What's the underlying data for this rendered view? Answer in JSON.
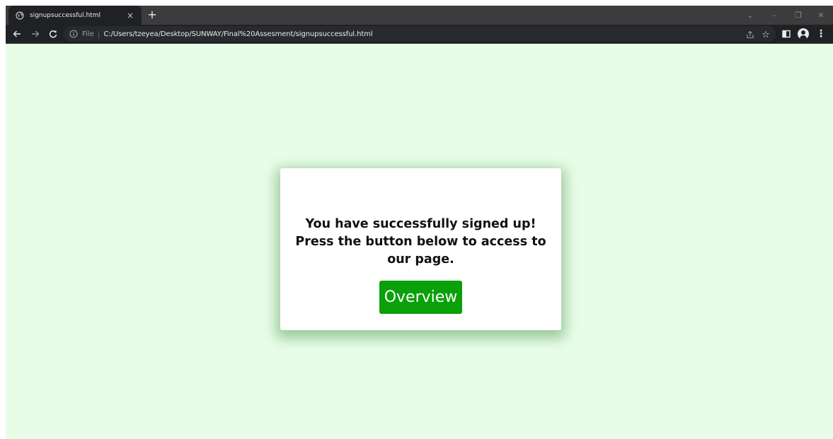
{
  "browser": {
    "tab": {
      "title": "signupsuccessful.html",
      "close_glyph": "×"
    },
    "new_tab_glyph": "+",
    "window_controls": {
      "dropdown": "⌄",
      "minimize": "–",
      "restore": "❐",
      "close": "✕"
    },
    "nav": {
      "back_glyph": "←",
      "forward_glyph": "→",
      "reload_glyph": "C"
    },
    "address_bar": {
      "scheme_label": "File",
      "separator": "|",
      "url": "C:/Users/tzeyea/Desktop/SUNWAY/Final%20Assesment/signupsuccessful.html"
    },
    "bookmark_glyph": "☆",
    "menu_glyph": "⋮"
  },
  "page": {
    "background_color": "#e8fde8",
    "message_lines": [
      "You have successfully signed up!",
      "Press the button below to access to",
      "our page."
    ],
    "button_label": "Overview",
    "button_color": "#0aa00a"
  },
  "icons": [
    "globe-icon",
    "info-icon",
    "share-icon",
    "star-icon",
    "side-panel-icon",
    "profile-icon",
    "kebab-menu-icon"
  ]
}
